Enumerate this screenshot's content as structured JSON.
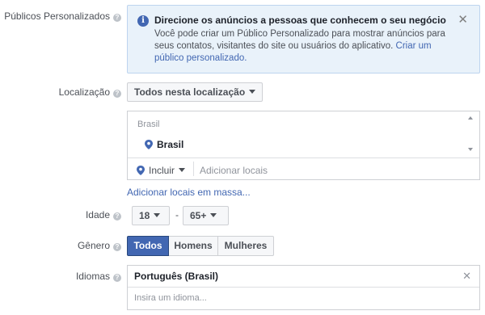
{
  "custom_audiences": {
    "label": "Públicos Personalizados",
    "info": {
      "title": "Direcione os anúncios a pessoas que conhecem o seu negócio",
      "body": "Você pode criar um Público Personalizado para mostrar anúncios para seus contatos, visitantes do site ou usuários do aplicativo. ",
      "link": "Criar um público personalizado."
    }
  },
  "location": {
    "label": "Localização",
    "dropdown": "Todos nesta localização",
    "list_header": "Brasil",
    "selected_item": "Brasil",
    "include_label": "Incluir",
    "add_placeholder": "Adicionar locais",
    "bulk_link": "Adicionar locais em massa..."
  },
  "age": {
    "label": "Idade",
    "min": "18",
    "separator": "-",
    "max": "65+"
  },
  "gender": {
    "label": "Gênero",
    "options": [
      "Todos",
      "Homens",
      "Mulheres"
    ],
    "selected": "Todos"
  },
  "languages": {
    "label": "Idiomas",
    "selected": "Português (Brasil)",
    "placeholder": "Insira um idioma..."
  },
  "icons": {
    "help": "question-circle-icon",
    "info": "info-icon",
    "close": "close-icon",
    "pin": "location-pin-icon",
    "caret": "chevron-down-icon"
  },
  "colors": {
    "accent": "#4267b2",
    "info_bg": "#e9f2fa",
    "label": "#4b4f56"
  }
}
